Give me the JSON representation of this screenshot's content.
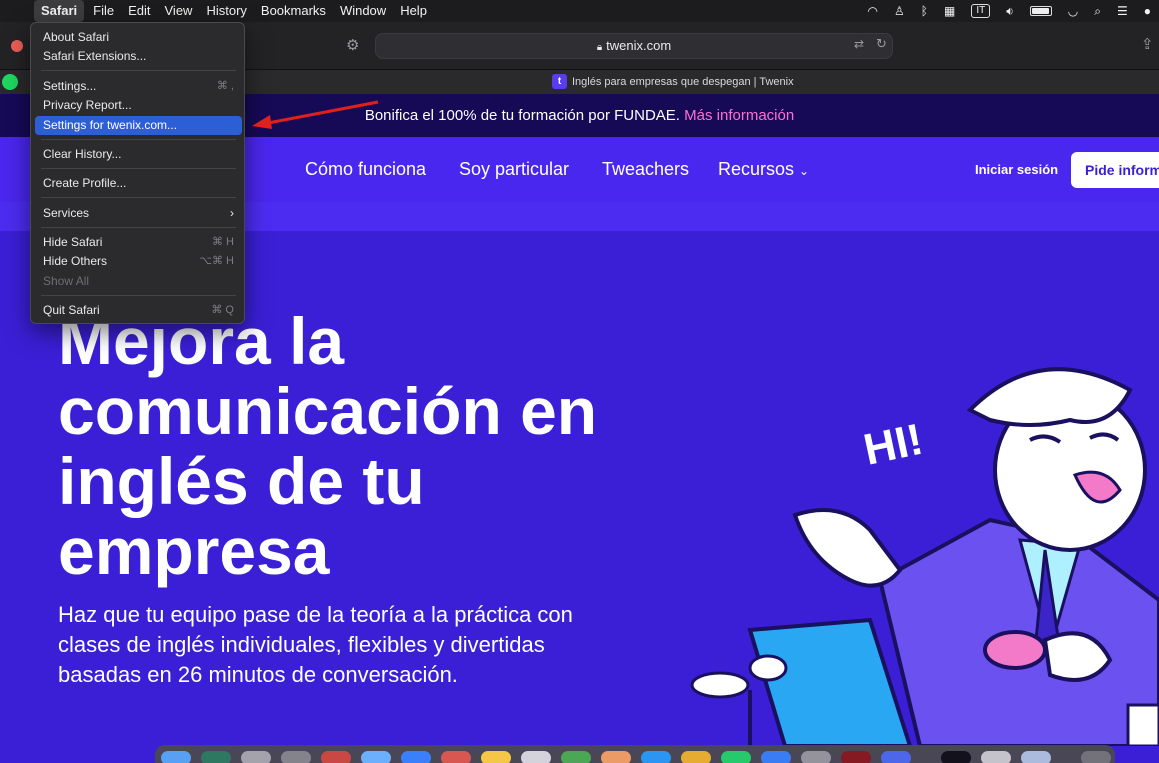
{
  "menubar": {
    "app": "Safari",
    "menus": [
      "File",
      "Edit",
      "View",
      "History",
      "Bookmarks",
      "Window",
      "Help"
    ],
    "input_source": "IT"
  },
  "toolbar": {
    "url": "twenix.com"
  },
  "tab": {
    "favicon": "t",
    "title": "Inglés para empresas que despegan | Twenix"
  },
  "safari_menu": {
    "items": [
      {
        "label": "About Safari",
        "shortcut": ""
      },
      {
        "label": "Safari Extensions...",
        "shortcut": ""
      },
      {
        "label": "Settings...",
        "shortcut": "⌘ ,"
      },
      {
        "label": "Privacy Report...",
        "shortcut": ""
      },
      {
        "label": "Settings for twenix.com...",
        "shortcut": ""
      },
      {
        "label": "Clear History...",
        "shortcut": ""
      },
      {
        "label": "Create Profile...",
        "shortcut": ""
      },
      {
        "label": "Services",
        "shortcut": "›"
      },
      {
        "label": "Hide Safari",
        "shortcut": "⌘ H"
      },
      {
        "label": "Hide Others",
        "shortcut": "⌥⌘ H"
      },
      {
        "label": "Show All",
        "shortcut": ""
      },
      {
        "label": "Quit Safari",
        "shortcut": "⌘ Q"
      }
    ]
  },
  "page": {
    "banner_text": "Bonifica el 100% de tu formación por FUNDAE.",
    "banner_link": "Más información",
    "nav": [
      "Cómo funciona",
      "Soy particular",
      "Tweachers",
      "Recursos"
    ],
    "login": "Iniciar sesión",
    "cta": "Pide inform",
    "hero_title": "Mejora la comunicación en inglés de tu empresa",
    "hero_subtitle": "Haz que tu equipo pase de la teoría a la práctica con clases de inglés individuales, flexibles y divertidas basadas en 26 minutos de conversación.",
    "illustration_text": "HI!"
  },
  "colors": {
    "brand": "#3a1fd6",
    "banner": "#160a57",
    "banner_link": "#ff6fd2",
    "menu_highlight": "#2c5fd6",
    "annotation_arrow": "#e0201b"
  }
}
